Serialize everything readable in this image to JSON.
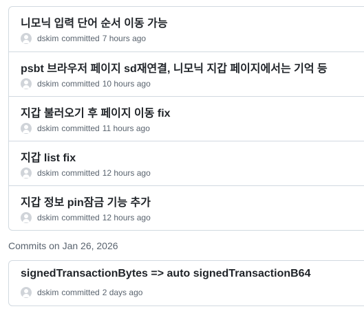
{
  "groups": [
    {
      "commits": [
        {
          "title": "니모닉 입력 단어 순서 이동 가능",
          "author": "dskim",
          "verb": "committed",
          "time": "7 hours ago"
        },
        {
          "title": "psbt 브라우저 페이지 sd재연결, 니모닉 지갑 페이지에서는 기억 등",
          "author": "dskim",
          "verb": "committed",
          "time": "10 hours ago"
        },
        {
          "title": "지갑 불러오기 후 페이지 이동 fix",
          "author": "dskim",
          "verb": "committed",
          "time": "11 hours ago"
        },
        {
          "title": "지갑 list fix",
          "author": "dskim",
          "verb": "committed",
          "time": "12 hours ago"
        },
        {
          "title": "지갑 정보 pin잠금 기능 추가",
          "author": "dskim",
          "verb": "committed",
          "time": "12 hours ago"
        }
      ]
    },
    {
      "header": "Commits on Jan 26, 2026",
      "commits": [
        {
          "title": "signedTransactionBytes => auto signedTransactionB64",
          "author": "dskim",
          "verb": "committed",
          "time": "2 days ago"
        }
      ]
    }
  ],
  "icons": {
    "avatar": "user-avatar-icon"
  }
}
